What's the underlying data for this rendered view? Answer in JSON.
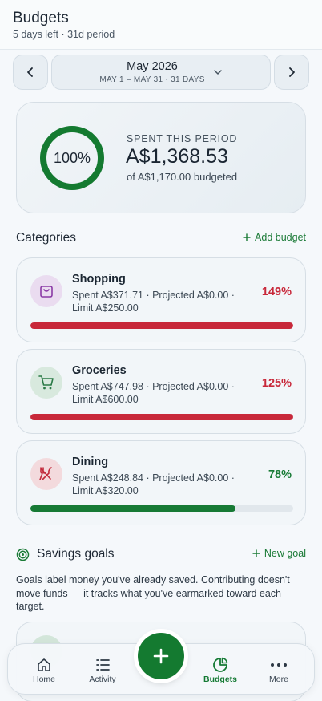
{
  "header": {
    "title": "Budgets",
    "subtitle": "5 days left · 31d period"
  },
  "period": {
    "month": "May 2026",
    "range": "MAY 1 – MAY 31 · 31 DAYS"
  },
  "summary": {
    "percent_label": "100%",
    "percent_value": 100,
    "spent_label": "SPENT THIS PERIOD",
    "spent_amount": "A$1,368.53",
    "budgeted": "of A$1,170.00 budgeted"
  },
  "categories_section": {
    "title": "Categories",
    "add_label": "Add budget"
  },
  "categories": [
    {
      "name": "Shopping",
      "detail": "Spent A$371.71 · Projected A$0.00 · Limit A$250.00",
      "percent": "149%",
      "fill": 1.0,
      "icon": "shopping-bag-icon",
      "color": "#c8283a",
      "icon_bg": "#eadcf0",
      "icon_color": "#8a3aa6"
    },
    {
      "name": "Groceries",
      "detail": "Spent A$747.98 · Projected A$0.00 · Limit A$600.00",
      "percent": "125%",
      "fill": 1.0,
      "icon": "cart-icon",
      "color": "#c8283a",
      "icon_bg": "#d8e9de",
      "icon_color": "#2a7a46"
    },
    {
      "name": "Dining",
      "detail": "Spent A$248.84 · Projected A$0.00 · Limit A$320.00",
      "percent": "78%",
      "fill": 0.78,
      "icon": "utensils-icon",
      "color": "#177a35",
      "icon_bg": "#f3dadd",
      "icon_color": "#c22a3b"
    }
  ],
  "goals_section": {
    "title": "Savings goals",
    "add_label": "New goal",
    "description": "Goals label money you've already saved. Contributing doesn't move funds — it tracks what you've earmarked toward each target."
  },
  "tabs": [
    {
      "label": "Home",
      "icon": "home-icon"
    },
    {
      "label": "Activity",
      "icon": "activity-list-icon"
    },
    {
      "label": "Budgets",
      "icon": "pie-chart-icon",
      "active": true
    },
    {
      "label": "More",
      "icon": "more-dots-icon"
    }
  ],
  "colors": {
    "accent": "#147a30",
    "over_budget": "#c8283a",
    "ring": "#147a30"
  }
}
